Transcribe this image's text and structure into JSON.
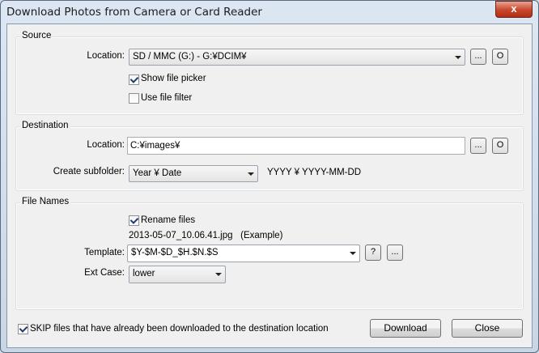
{
  "window": {
    "title": "Download Photos from Camera or Card Reader",
    "close_glyph": "x"
  },
  "source": {
    "group_title": "Source",
    "location_label": "Location:",
    "location_value": "SD / MMC (G:) - G:¥DCIM¥",
    "browse_label": "...",
    "open_label": "O",
    "show_file_picker": {
      "label": "Show file picker",
      "checked": true
    },
    "use_file_filter": {
      "label": "Use file filter",
      "checked": false
    }
  },
  "destination": {
    "group_title": "Destination",
    "location_label": "Location:",
    "location_value": "C:¥images¥",
    "browse_label": "...",
    "open_label": "O",
    "subfolder_label": "Create subfolder:",
    "subfolder_value": "Year ¥ Date",
    "subfolder_example": "YYYY ¥ YYYY-MM-DD"
  },
  "file_names": {
    "group_title": "File Names",
    "rename_files": {
      "label": "Rename files",
      "checked": true
    },
    "example_text": "2013-05-07_10.06.41.jpg   (Example)",
    "template_label": "Template:",
    "template_value": "$Y-$M-$D_$H.$N.$S",
    "help_label": "?",
    "browse_label": "...",
    "ext_case_label": "Ext Case:",
    "ext_case_value": "lower"
  },
  "footer": {
    "skip_downloaded": {
      "label": "SKIP files that have already been downloaded to the destination location",
      "checked": true
    },
    "download_label": "Download",
    "close_label": "Close"
  }
}
